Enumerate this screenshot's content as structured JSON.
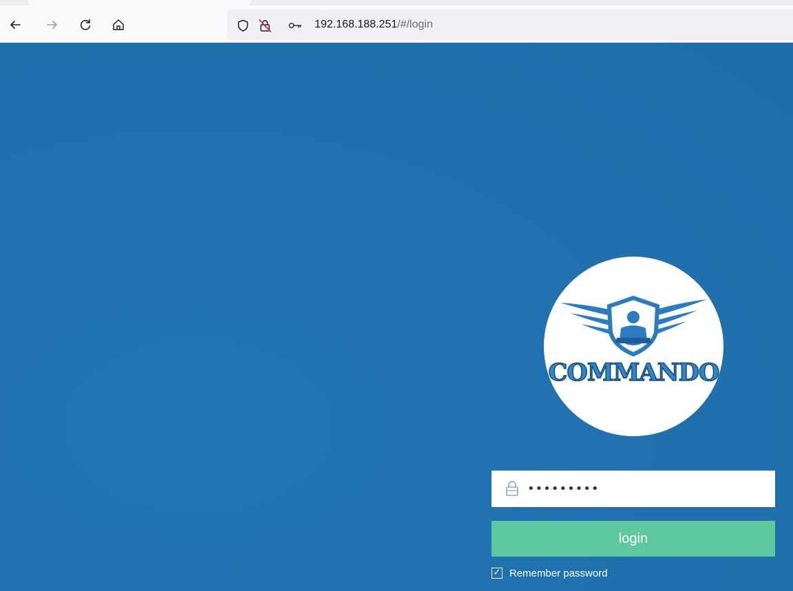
{
  "browser": {
    "url_host": "192.168.188.251",
    "url_path": "/#/login",
    "icons": {
      "back": "back-arrow-icon",
      "forward": "forward-arrow-icon",
      "reload": "reload-icon",
      "home": "home-icon",
      "tracking": "shield-icon",
      "insecure": "insecure-lock-icon",
      "permissions": "key-icon"
    }
  },
  "login": {
    "logo_text": "COMMANDO",
    "password_value": "•••••••••",
    "login_label": "login",
    "remember_label": "Remember password",
    "remember_checked": true
  },
  "colors": {
    "page_background": "#1f6fad",
    "login_button": "#5ec8a0",
    "logo_accent": "#2f86c8"
  }
}
